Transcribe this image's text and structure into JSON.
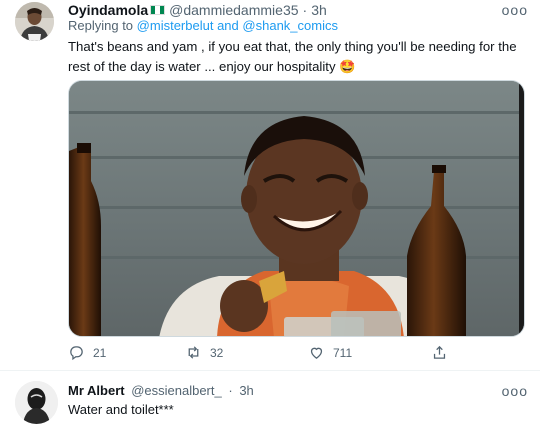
{
  "tweet": {
    "author_name": "Oyindamola",
    "author_handle": "@dammiedammie35",
    "separator": "·",
    "time": "3h",
    "more": "ooo",
    "replying_to_label": "Replying to",
    "mention_1": "@misterbelut",
    "and_label": "and",
    "mention_2": "@shank_comics",
    "text": "That's beans and yam , if you eat that, the only thing you'll be needing for the rest of the day is water ... enjoy our hospitality",
    "emoji": "🤩",
    "replies": "21",
    "retweets": "32",
    "likes": "711",
    "flag_colors": [
      "#008751",
      "#ffffff",
      "#008751"
    ]
  },
  "reply": {
    "author_name": "Mr Albert",
    "author_handle": "@essienalbert_",
    "separator": "·",
    "time": "3h",
    "more": "ooo",
    "text": "Water and toilet***"
  },
  "colors": {
    "accent": "#1d9bf0",
    "secondary_text": "#536471"
  }
}
